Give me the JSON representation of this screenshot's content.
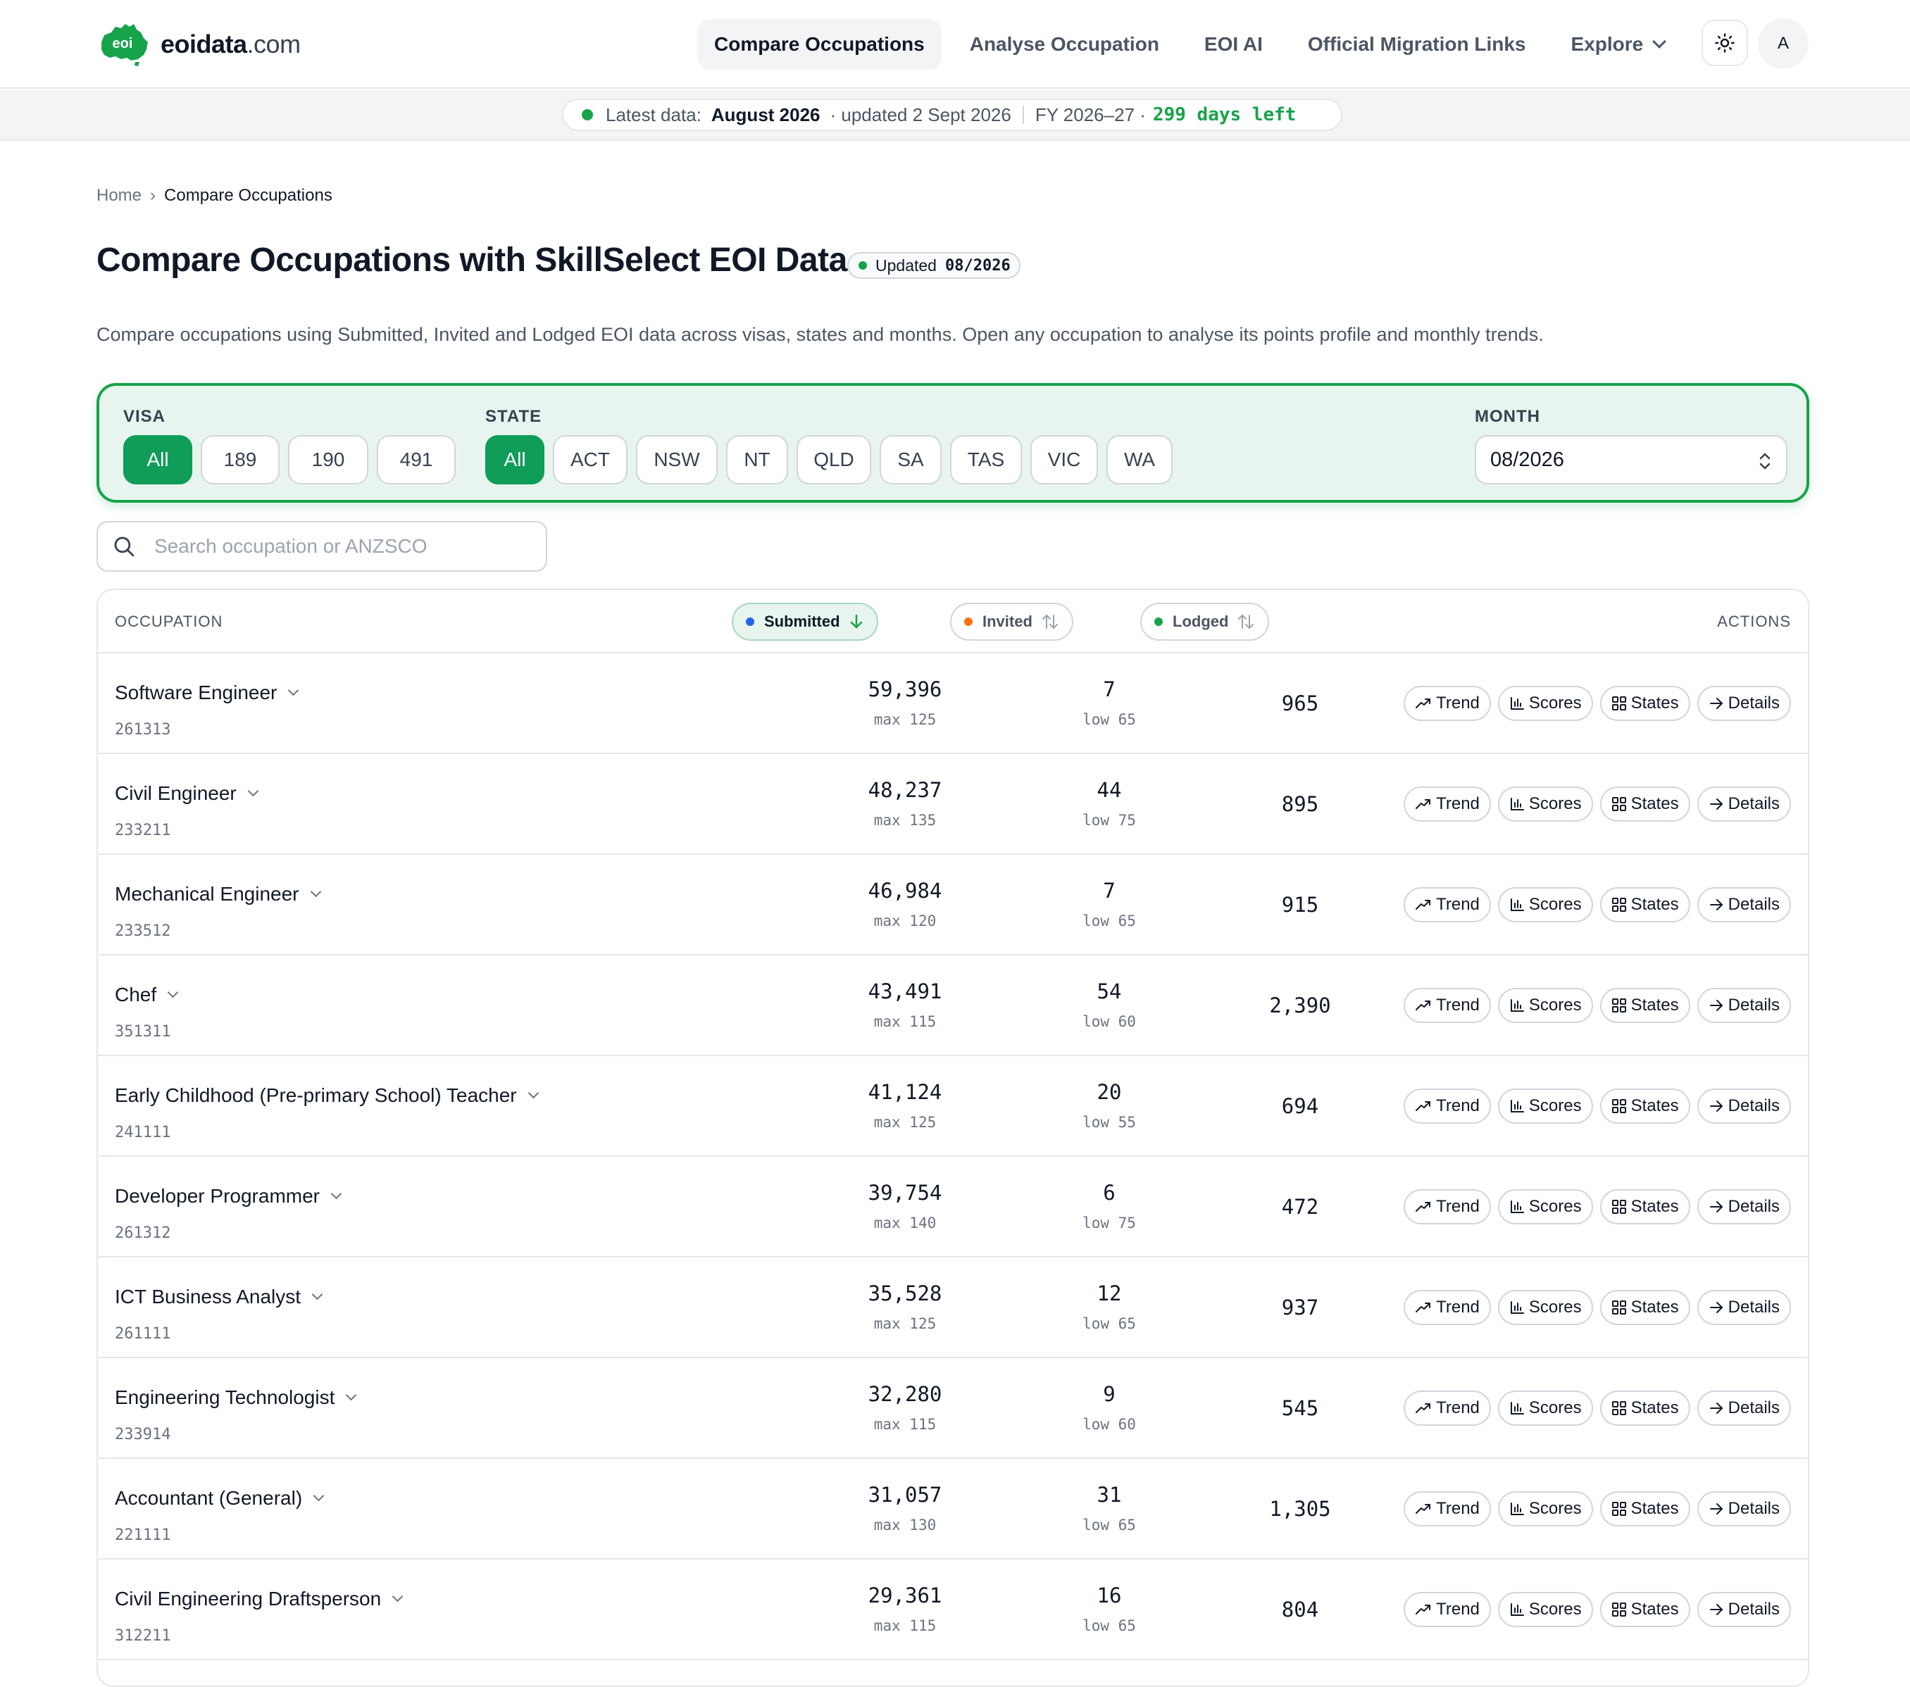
{
  "brand": {
    "logo_badge": "eoi",
    "name_bold": "eoidata",
    "name_suffix": ".com",
    "accent": "#0f9d58"
  },
  "nav": {
    "items": [
      {
        "label": "Compare Occupations",
        "active": true
      },
      {
        "label": "Analyse Occupation"
      },
      {
        "label": "EOI AI"
      },
      {
        "label": "Official Migration Links"
      },
      {
        "label": "Explore",
        "has_menu": true
      }
    ],
    "theme_icon": "sun-icon",
    "avatar_initial": "A"
  },
  "status": {
    "label": "Latest data:",
    "month": "August 2026",
    "updated": "· updated 2 Sept 2026",
    "fy": "FY 2026–27 ·",
    "days_left": "299 days left"
  },
  "breadcrumb": {
    "home": "Home",
    "separator": "›",
    "current": "Compare Occupations"
  },
  "page": {
    "title": "Compare Occupations with SkillSelect EOI Data",
    "updated_label": "Updated",
    "updated_value": "08/2026",
    "description": "Compare occupations using Submitted, Invited and Lodged EOI data across visas, states and months. Open any occupation to analyse its points profile and monthly trends."
  },
  "filters": {
    "visa_label": "VISA",
    "visa_options": [
      "All",
      "189",
      "190",
      "491"
    ],
    "visa_selected": "All",
    "state_label": "STATE",
    "state_options": [
      "All",
      "ACT",
      "NSW",
      "NT",
      "QLD",
      "SA",
      "TAS",
      "VIC",
      "WA"
    ],
    "state_selected": "All",
    "month_label": "MONTH",
    "month_value": "08/2026"
  },
  "search": {
    "placeholder": "Search occupation or ANZSCO"
  },
  "table": {
    "headers": {
      "occupation": "OCCUPATION",
      "submitted": "Submitted",
      "invited": "Invited",
      "lodged": "Lodged",
      "actions": "ACTIONS"
    },
    "series_colors": {
      "submitted": "#2563eb",
      "invited": "#f97316",
      "lodged": "#16a34a"
    },
    "action_labels": [
      "Trend",
      "Scores",
      "States",
      "Details"
    ],
    "rows": [
      {
        "name": "Software Engineer",
        "code": "261313",
        "submitted": "59,396",
        "submitted_sub": "max 125",
        "invited": "7",
        "invited_sub": "low 65",
        "lodged": "965"
      },
      {
        "name": "Civil Engineer",
        "code": "233211",
        "submitted": "48,237",
        "submitted_sub": "max 135",
        "invited": "44",
        "invited_sub": "low 75",
        "lodged": "895"
      },
      {
        "name": "Mechanical Engineer",
        "code": "233512",
        "submitted": "46,984",
        "submitted_sub": "max 120",
        "invited": "7",
        "invited_sub": "low 65",
        "lodged": "915"
      },
      {
        "name": "Chef",
        "code": "351311",
        "submitted": "43,491",
        "submitted_sub": "max 115",
        "invited": "54",
        "invited_sub": "low 60",
        "lodged": "2,390"
      },
      {
        "name": "Early Childhood (Pre-primary School) Teacher",
        "code": "241111",
        "submitted": "41,124",
        "submitted_sub": "max 125",
        "invited": "20",
        "invited_sub": "low 55",
        "lodged": "694"
      },
      {
        "name": "Developer Programmer",
        "code": "261312",
        "submitted": "39,754",
        "submitted_sub": "max 140",
        "invited": "6",
        "invited_sub": "low 75",
        "lodged": "472"
      },
      {
        "name": "ICT Business Analyst",
        "code": "261111",
        "submitted": "35,528",
        "submitted_sub": "max 125",
        "invited": "12",
        "invited_sub": "low 65",
        "lodged": "937"
      },
      {
        "name": "Engineering Technologist",
        "code": "233914",
        "submitted": "32,280",
        "submitted_sub": "max 115",
        "invited": "9",
        "invited_sub": "low 60",
        "lodged": "545"
      },
      {
        "name": "Accountant (General)",
        "code": "221111",
        "submitted": "31,057",
        "submitted_sub": "max 130",
        "invited": "31",
        "invited_sub": "low 65",
        "lodged": "1,305"
      },
      {
        "name": "Civil Engineering Draftsperson",
        "code": "312211",
        "submitted": "29,361",
        "submitted_sub": "max 115",
        "invited": "16",
        "invited_sub": "low 65",
        "lodged": "804"
      }
    ]
  }
}
